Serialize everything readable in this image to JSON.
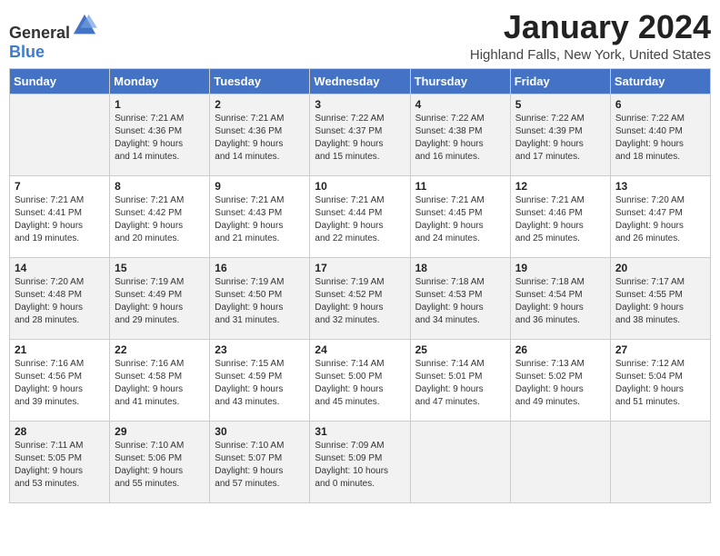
{
  "header": {
    "logo_general": "General",
    "logo_blue": "Blue",
    "month_title": "January 2024",
    "location": "Highland Falls, New York, United States"
  },
  "days_of_week": [
    "Sunday",
    "Monday",
    "Tuesday",
    "Wednesday",
    "Thursday",
    "Friday",
    "Saturday"
  ],
  "weeks": [
    [
      {
        "day": "",
        "info": ""
      },
      {
        "day": "1",
        "info": "Sunrise: 7:21 AM\nSunset: 4:36 PM\nDaylight: 9 hours\nand 14 minutes."
      },
      {
        "day": "2",
        "info": "Sunrise: 7:21 AM\nSunset: 4:36 PM\nDaylight: 9 hours\nand 14 minutes."
      },
      {
        "day": "3",
        "info": "Sunrise: 7:22 AM\nSunset: 4:37 PM\nDaylight: 9 hours\nand 15 minutes."
      },
      {
        "day": "4",
        "info": "Sunrise: 7:22 AM\nSunset: 4:38 PM\nDaylight: 9 hours\nand 16 minutes."
      },
      {
        "day": "5",
        "info": "Sunrise: 7:22 AM\nSunset: 4:39 PM\nDaylight: 9 hours\nand 17 minutes."
      },
      {
        "day": "6",
        "info": "Sunrise: 7:22 AM\nSunset: 4:40 PM\nDaylight: 9 hours\nand 18 minutes."
      }
    ],
    [
      {
        "day": "7",
        "info": "Sunrise: 7:21 AM\nSunset: 4:41 PM\nDaylight: 9 hours\nand 19 minutes."
      },
      {
        "day": "8",
        "info": "Sunrise: 7:21 AM\nSunset: 4:42 PM\nDaylight: 9 hours\nand 20 minutes."
      },
      {
        "day": "9",
        "info": "Sunrise: 7:21 AM\nSunset: 4:43 PM\nDaylight: 9 hours\nand 21 minutes."
      },
      {
        "day": "10",
        "info": "Sunrise: 7:21 AM\nSunset: 4:44 PM\nDaylight: 9 hours\nand 22 minutes."
      },
      {
        "day": "11",
        "info": "Sunrise: 7:21 AM\nSunset: 4:45 PM\nDaylight: 9 hours\nand 24 minutes."
      },
      {
        "day": "12",
        "info": "Sunrise: 7:21 AM\nSunset: 4:46 PM\nDaylight: 9 hours\nand 25 minutes."
      },
      {
        "day": "13",
        "info": "Sunrise: 7:20 AM\nSunset: 4:47 PM\nDaylight: 9 hours\nand 26 minutes."
      }
    ],
    [
      {
        "day": "14",
        "info": "Sunrise: 7:20 AM\nSunset: 4:48 PM\nDaylight: 9 hours\nand 28 minutes."
      },
      {
        "day": "15",
        "info": "Sunrise: 7:19 AM\nSunset: 4:49 PM\nDaylight: 9 hours\nand 29 minutes."
      },
      {
        "day": "16",
        "info": "Sunrise: 7:19 AM\nSunset: 4:50 PM\nDaylight: 9 hours\nand 31 minutes."
      },
      {
        "day": "17",
        "info": "Sunrise: 7:19 AM\nSunset: 4:52 PM\nDaylight: 9 hours\nand 32 minutes."
      },
      {
        "day": "18",
        "info": "Sunrise: 7:18 AM\nSunset: 4:53 PM\nDaylight: 9 hours\nand 34 minutes."
      },
      {
        "day": "19",
        "info": "Sunrise: 7:18 AM\nSunset: 4:54 PM\nDaylight: 9 hours\nand 36 minutes."
      },
      {
        "day": "20",
        "info": "Sunrise: 7:17 AM\nSunset: 4:55 PM\nDaylight: 9 hours\nand 38 minutes."
      }
    ],
    [
      {
        "day": "21",
        "info": "Sunrise: 7:16 AM\nSunset: 4:56 PM\nDaylight: 9 hours\nand 39 minutes."
      },
      {
        "day": "22",
        "info": "Sunrise: 7:16 AM\nSunset: 4:58 PM\nDaylight: 9 hours\nand 41 minutes."
      },
      {
        "day": "23",
        "info": "Sunrise: 7:15 AM\nSunset: 4:59 PM\nDaylight: 9 hours\nand 43 minutes."
      },
      {
        "day": "24",
        "info": "Sunrise: 7:14 AM\nSunset: 5:00 PM\nDaylight: 9 hours\nand 45 minutes."
      },
      {
        "day": "25",
        "info": "Sunrise: 7:14 AM\nSunset: 5:01 PM\nDaylight: 9 hours\nand 47 minutes."
      },
      {
        "day": "26",
        "info": "Sunrise: 7:13 AM\nSunset: 5:02 PM\nDaylight: 9 hours\nand 49 minutes."
      },
      {
        "day": "27",
        "info": "Sunrise: 7:12 AM\nSunset: 5:04 PM\nDaylight: 9 hours\nand 51 minutes."
      }
    ],
    [
      {
        "day": "28",
        "info": "Sunrise: 7:11 AM\nSunset: 5:05 PM\nDaylight: 9 hours\nand 53 minutes."
      },
      {
        "day": "29",
        "info": "Sunrise: 7:10 AM\nSunset: 5:06 PM\nDaylight: 9 hours\nand 55 minutes."
      },
      {
        "day": "30",
        "info": "Sunrise: 7:10 AM\nSunset: 5:07 PM\nDaylight: 9 hours\nand 57 minutes."
      },
      {
        "day": "31",
        "info": "Sunrise: 7:09 AM\nSunset: 5:09 PM\nDaylight: 10 hours\nand 0 minutes."
      },
      {
        "day": "",
        "info": ""
      },
      {
        "day": "",
        "info": ""
      },
      {
        "day": "",
        "info": ""
      }
    ]
  ]
}
